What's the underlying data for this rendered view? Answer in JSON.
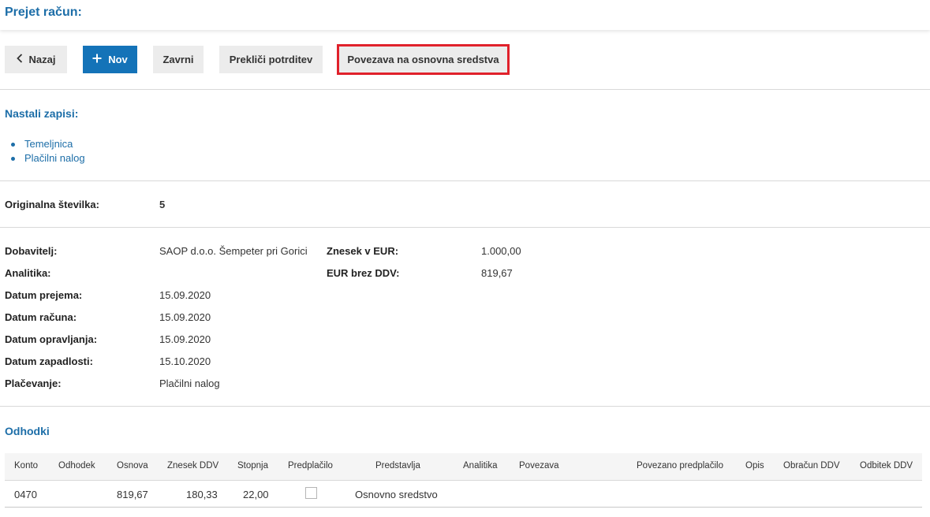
{
  "header": {
    "title": "Prejet račun:"
  },
  "toolbar": {
    "back_label": "Nazaj",
    "new_label": "Nov",
    "finish_label": "Zavrni",
    "cancel_confirm_label": "Prekliči potrditev",
    "link_assets_label": "Povezava na osnovna sredstva",
    "highlight_color": "#e0212b",
    "primary_color": "#1473b8"
  },
  "records": {
    "title": "Nastali zapisi:",
    "items": [
      "Temeljnica",
      "Plačilni nalog"
    ]
  },
  "original": {
    "label": "Originalna številka:",
    "value": "5"
  },
  "details": {
    "supplier_label": "Dobavitelj:",
    "supplier_value": "SAOP d.o.o. Šempeter pri Gorici",
    "analytics_label": "Analitika:",
    "received_label": "Datum prejema:",
    "received_value": "15.09.2020",
    "invoice_date_label": "Datum računa:",
    "invoice_date_value": "15.09.2020",
    "service_date_label": "Datum opravljanja:",
    "service_date_value": "15.09.2020",
    "due_date_label": "Datum zapadlosti:",
    "due_date_value": "15.10.2020",
    "payment_label": "Plačevanje:",
    "payment_value": "Plačilni nalog",
    "amount_label": "Znesek v EUR:",
    "amount_value": "1.000,00",
    "net_label": "EUR brez DDV:",
    "net_value": "819,67"
  },
  "expenses": {
    "title": "Odhodki",
    "columns": [
      "Konto",
      "Odhodek",
      "Osnova",
      "Znesek DDV",
      "Stopnja",
      "Predplačilo",
      "Predstavlja",
      "Analitika",
      "Povezava",
      "Povezano predplačilo",
      "Opis",
      "Obračun DDV",
      "Odbitek DDV"
    ],
    "rows": [
      {
        "konto": "0470",
        "osnova": "819,67",
        "znesek_ddv": "180,33",
        "stopnja": "22,00",
        "predplacilo": false,
        "predstavlja": "Osnovno sredstvo"
      }
    ]
  }
}
